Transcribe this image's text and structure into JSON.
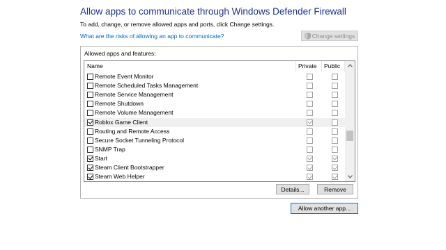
{
  "header": {
    "title": "Allow apps to communicate through Windows Defender Firewall",
    "subtitle": "To add, change, or remove allowed apps and ports, click Change settings.",
    "risk_link": "What are the risks of allowing an app to communicate?",
    "change_settings_label": "Change settings"
  },
  "panel": {
    "label": "Allowed apps and features:",
    "columns": {
      "name": "Name",
      "private": "Private",
      "public": "Public"
    },
    "rows": [
      {
        "name": "Remote Event Monitor",
        "enabled": false,
        "private": false,
        "public": false
      },
      {
        "name": "Remote Scheduled Tasks Management",
        "enabled": false,
        "private": false,
        "public": false
      },
      {
        "name": "Remote Service Management",
        "enabled": false,
        "private": false,
        "public": false
      },
      {
        "name": "Remote Shutdown",
        "enabled": false,
        "private": false,
        "public": false
      },
      {
        "name": "Remote Volume Management",
        "enabled": false,
        "private": false,
        "public": false
      },
      {
        "name": "Roblox Game Client",
        "enabled": true,
        "private": true,
        "public": false,
        "highlighted": true
      },
      {
        "name": "Routing and Remote Access",
        "enabled": false,
        "private": false,
        "public": false
      },
      {
        "name": "Secure Socket Tunneling Protocol",
        "enabled": false,
        "private": false,
        "public": false
      },
      {
        "name": "SNMP Trap",
        "enabled": false,
        "private": false,
        "public": false
      },
      {
        "name": "Start",
        "enabled": true,
        "private": true,
        "public": true
      },
      {
        "name": "Steam Client Bootstrapper",
        "enabled": true,
        "private": true,
        "public": true
      },
      {
        "name": "Steam Web Helper",
        "enabled": true,
        "private": true,
        "public": true
      }
    ],
    "details_label": "Details...",
    "remove_label": "Remove"
  },
  "allow_another_label": "Allow another app...",
  "colors": {
    "title": "#1e3287",
    "link": "#0066cc",
    "accent": "#0078d7"
  },
  "icons": {
    "change_settings": "uac-shield-icon",
    "scroll_up": "chevron-up-icon",
    "scroll_down": "chevron-down-icon"
  }
}
